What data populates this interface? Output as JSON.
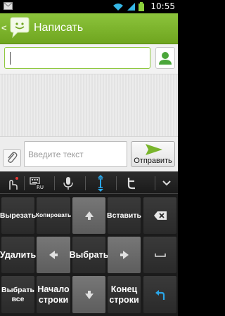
{
  "status_bar": {
    "time": "10:55",
    "icons": [
      "mail-icon",
      "wifi-icon",
      "signal-icon",
      "battery-icon"
    ]
  },
  "action_bar": {
    "back_glyph": "<",
    "title": "Написать"
  },
  "recipient": {
    "value": "",
    "contact_icon": "contact-icon"
  },
  "compose": {
    "placeholder": "Введите текст",
    "send_label": "Отправить",
    "attach_icon": "paperclip-icon"
  },
  "keyboard_toolbar": {
    "lang_badge": "RU",
    "tools": [
      "gesture-icon",
      "keyboard-language-icon",
      "microphone-icon",
      "text-cursor-icon",
      "twitter-icon",
      "collapse-icon"
    ]
  },
  "keyboard": {
    "cut": "Вырезать",
    "copy": "Копировать",
    "paste": "Вставить",
    "delete": "Удалить",
    "select": "Выбрать",
    "select_all": "Выбрать все",
    "line_start": "Начало строки",
    "line_end": "Конец строки"
  },
  "colors": {
    "accent_green": "#7cb82f",
    "keyboard_blue": "#2aa6e8"
  }
}
